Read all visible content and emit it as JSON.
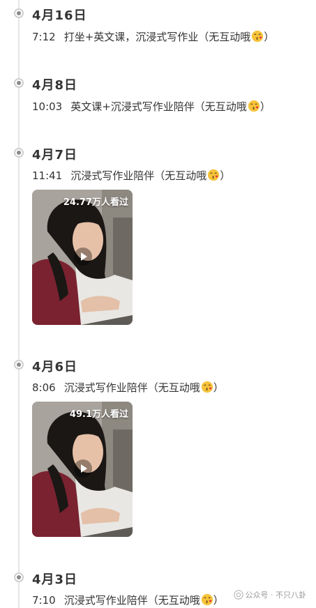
{
  "entries": [
    {
      "date": "4月16日",
      "time": "7:12",
      "text": "打坐+英文课，沉浸式写作业（无互动哦",
      "close": "）"
    },
    {
      "date": "4月8日",
      "time": "10:03",
      "text": "英文课+沉浸式写作业陪伴（无互动哦",
      "close": "）"
    },
    {
      "date": "4月7日",
      "time": "11:41",
      "text": "沉浸式写作业陪伴（无互动哦",
      "close": "）",
      "video_views": "24.77万人看过"
    },
    {
      "date": "4月6日",
      "time": "8:06",
      "text": "沉浸式写作业陪伴（无互动哦",
      "close": "）",
      "video_views": "49.1万人看过"
    },
    {
      "date": "4月3日",
      "time": "7:10",
      "text": "沉浸式写作业陪伴（无互动哦",
      "close": "）"
    }
  ],
  "icons": {
    "emoji": "face-blowing-kiss-emoji",
    "play": "play-icon",
    "timeline_dot": "timeline-dot-icon",
    "watermark": "wechat-official-account-icon"
  },
  "watermark": "公众号 · 不只八卦",
  "colors": {
    "text": "#333333",
    "timeline": "#e6e6e6",
    "emoji": "#f6c33a",
    "sweater": "#7a2230"
  }
}
